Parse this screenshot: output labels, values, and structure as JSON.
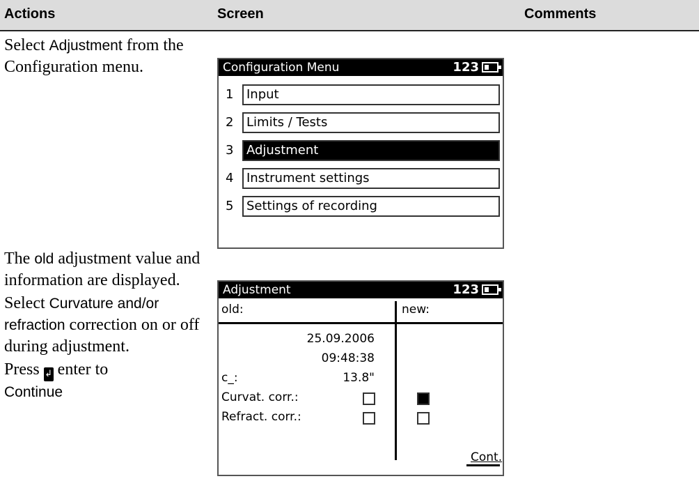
{
  "header": {
    "col_actions": "Actions",
    "col_screen": "Screen",
    "col_comments": "Comments"
  },
  "step1": {
    "text_a": "Select ",
    "text_sans": "Adjustment",
    "text_b": " from the Configuration menu."
  },
  "screen1": {
    "title": "Configuration Menu",
    "status": "123",
    "items": [
      {
        "num": "1",
        "label": "Input",
        "selected": false
      },
      {
        "num": "2",
        "label": "Limits / Tests",
        "selected": false
      },
      {
        "num": "3",
        "label": "Adjustment",
        "selected": true
      },
      {
        "num": "4",
        "label": "Instrument settings",
        "selected": false
      },
      {
        "num": "5",
        "label": "Settings of recording",
        "selected": false
      }
    ]
  },
  "step2": {
    "p1_a": "The ",
    "p1_sans": "old",
    "p1_b": " adjustment value and information are displayed.",
    "p2_a": "Select ",
    "p2_sans1": "Curvature",
    "p2_mid": " and/or ",
    "p2_sans2": "refraction",
    "p2_c": " correction on or off during adjustment.",
    "p3_a": "Press ",
    "p3_b": " enter to ",
    "p3_sans": "Continue"
  },
  "screen2": {
    "title": "Adjustment",
    "status": "123",
    "old_label": "old:",
    "new_label": "new:",
    "date": "25.09.2006",
    "time": "09:48:38",
    "c_label": "c_:",
    "c_value": "13.8\"",
    "curv_label": "Curvat. corr.:",
    "refr_label": "Refract. corr.:",
    "curv_old": false,
    "curv_new": true,
    "refr_old": false,
    "refr_new": false,
    "cont_label": "Cont."
  }
}
